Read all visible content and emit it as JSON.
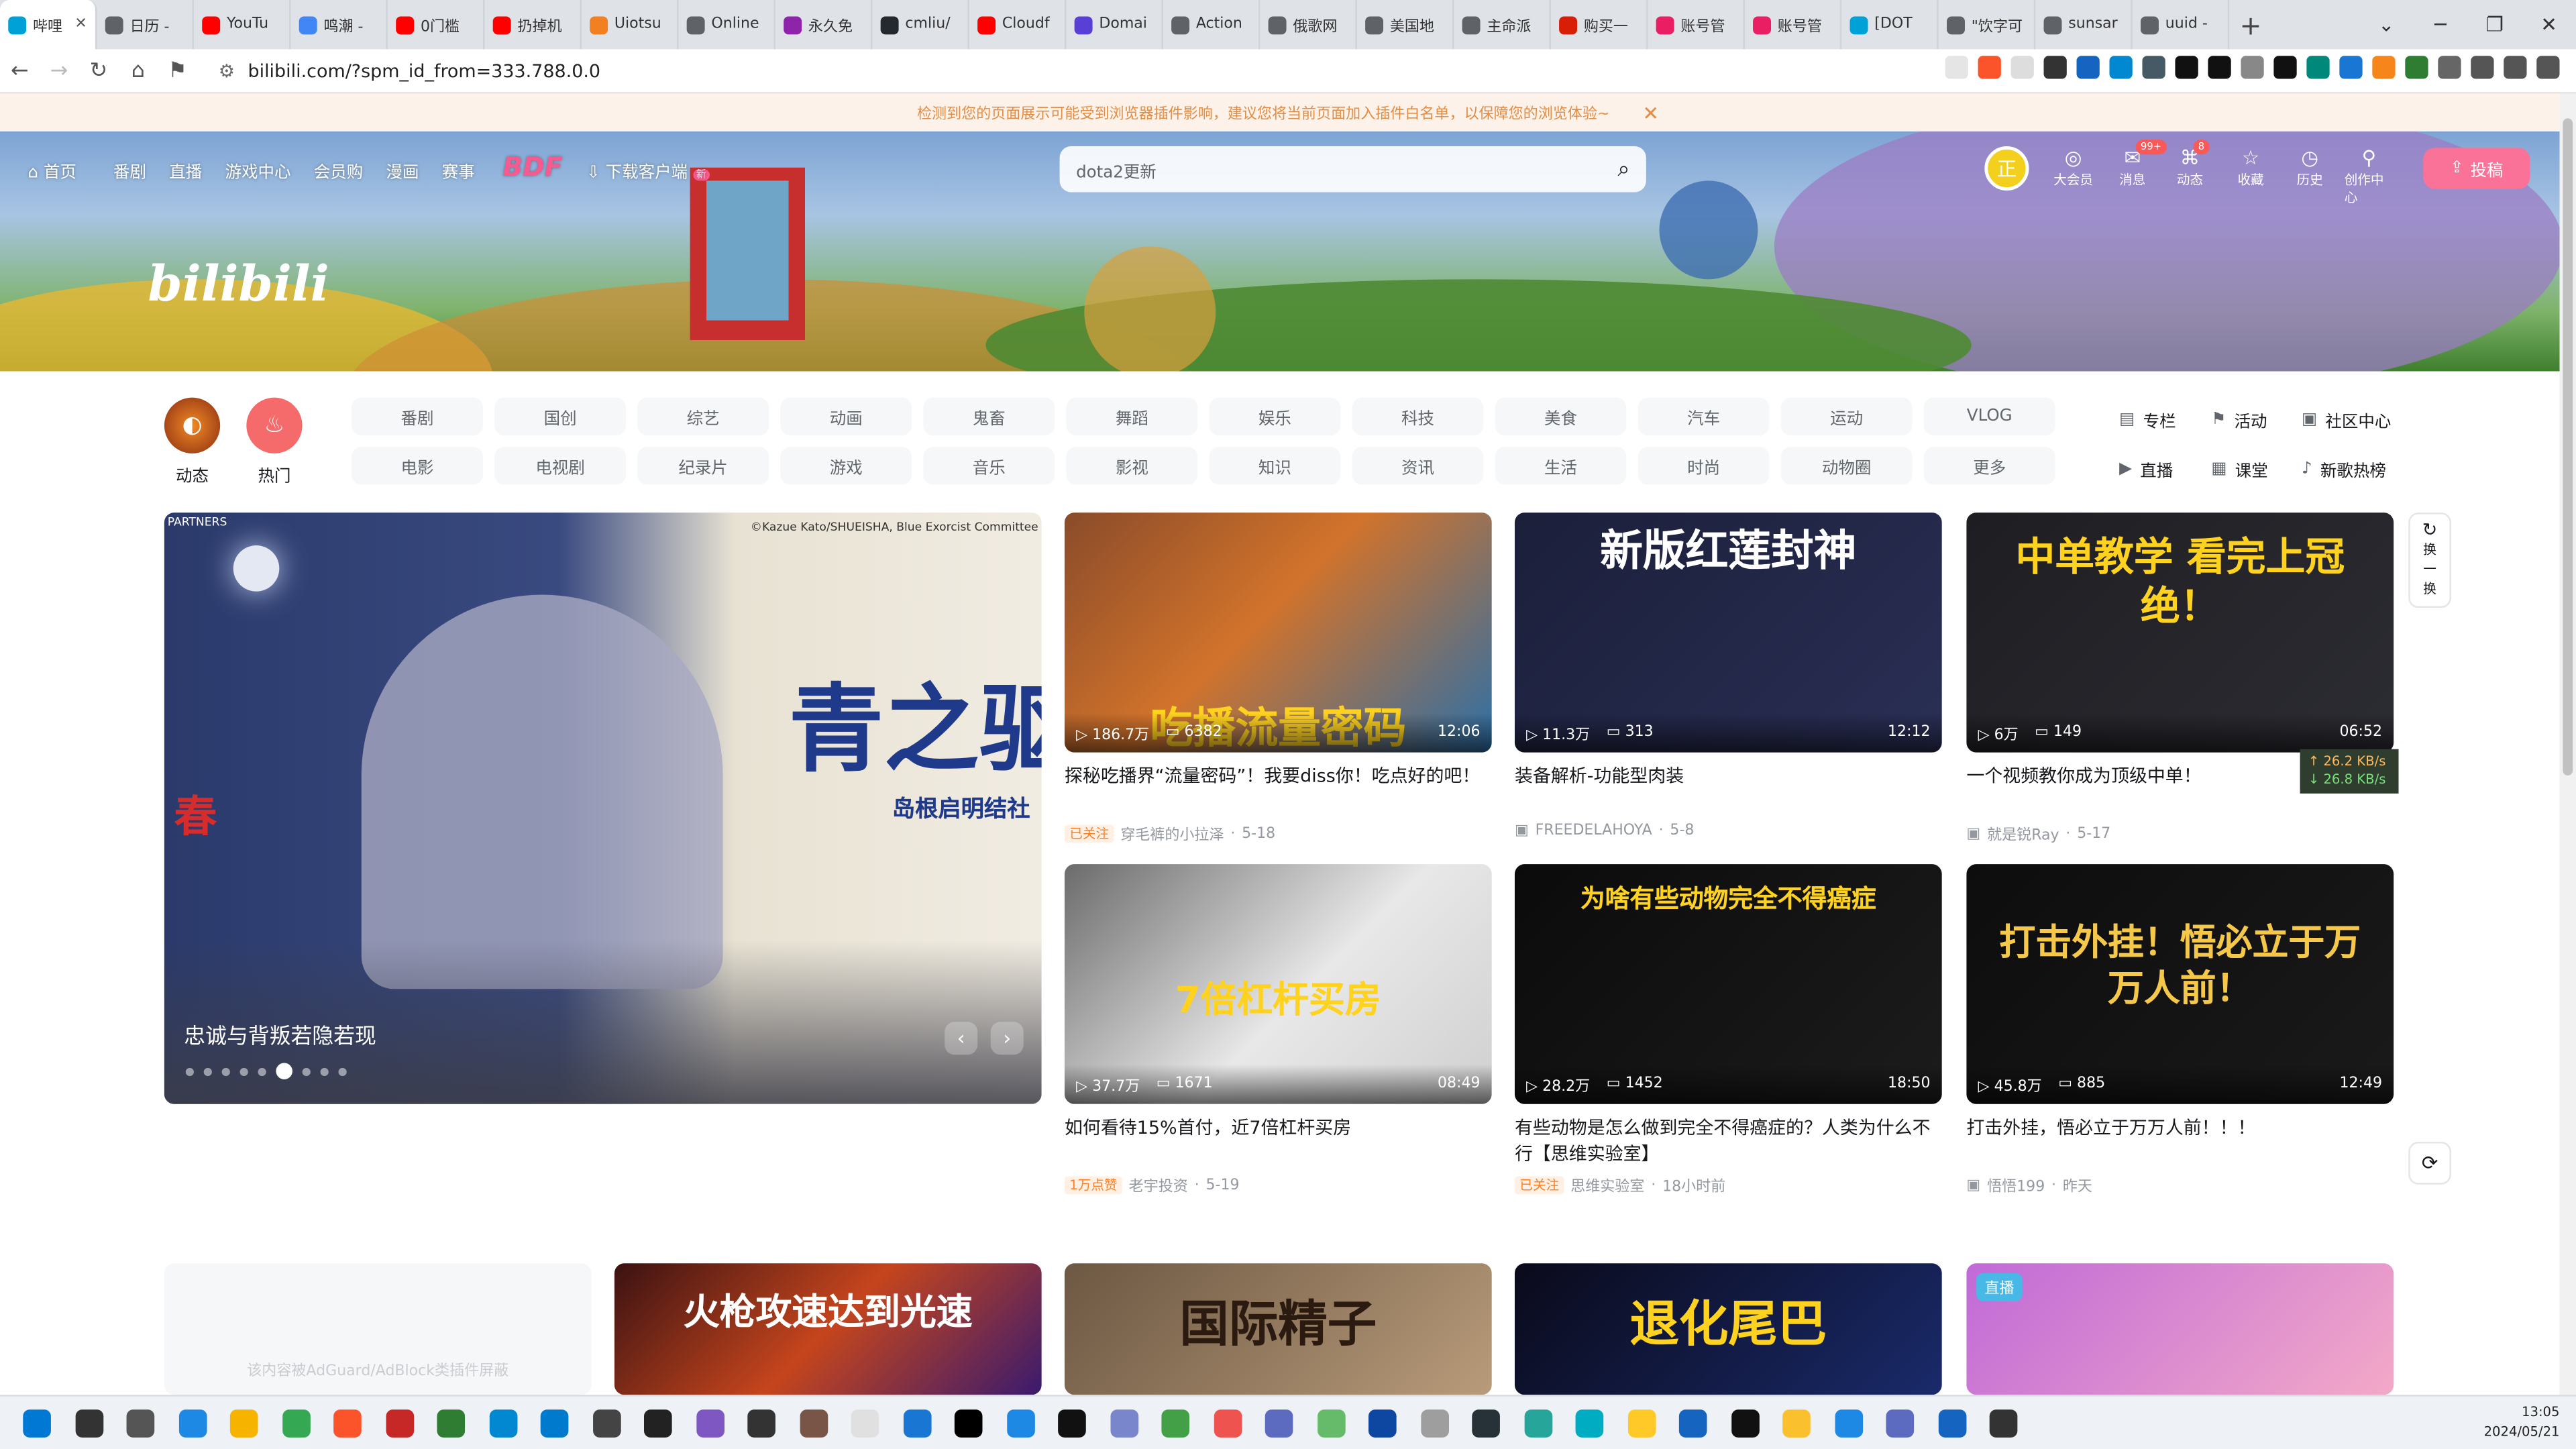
{
  "browser": {
    "tabs": [
      {
        "title": "哔哩",
        "color": "#00a1d6"
      },
      {
        "title": "日历 -",
        "color": "#5f6368"
      },
      {
        "title": "YouTu",
        "color": "#ff0000"
      },
      {
        "title": "鸣潮 -",
        "color": "#4285f4"
      },
      {
        "title": "0门槛",
        "color": "#ff0000"
      },
      {
        "title": "扔掉机",
        "color": "#ff0000"
      },
      {
        "title": "Uiotsu",
        "color": "#f38020"
      },
      {
        "title": "Online",
        "color": "#5f6368"
      },
      {
        "title": "永久免",
        "color": "#8e24aa"
      },
      {
        "title": "cmliu/",
        "color": "#24292f"
      },
      {
        "title": "Cloudf",
        "color": "#ff0000"
      },
      {
        "title": "Domai",
        "color": "#5a3fd6"
      },
      {
        "title": "Action",
        "color": "#5f6368"
      },
      {
        "title": "俄歌网",
        "color": "#5f6368"
      },
      {
        "title": "美国地",
        "color": "#5f6368"
      },
      {
        "title": "主命派",
        "color": "#5f6368"
      },
      {
        "title": "购买一",
        "color": "#d81e06"
      },
      {
        "title": "账号管",
        "color": "#e91e63"
      },
      {
        "title": "账号管",
        "color": "#e91e63"
      },
      {
        "title": "[DOT",
        "color": "#00a1d6"
      },
      {
        "title": "\"饮字可",
        "color": "#5f6368"
      },
      {
        "title": "sunsar",
        "color": "#5f6368"
      },
      {
        "title": "uuid -",
        "color": "#5f6368"
      }
    ],
    "new_tab": "+",
    "url": "bilibili.com/?spm_id_from=333.788.0.0",
    "warning": "检测到您的页面展示可能受到浏览器插件影响，建议您将当前页面加入插件白名单，以保障您的浏览体验~"
  },
  "topnav": {
    "left": [
      "首页",
      "番剧",
      "直播",
      "游戏中心",
      "会员购",
      "漫画",
      "赛事"
    ],
    "bdf": "BDF",
    "download": "下载客户端",
    "download_badge": "新",
    "search_value": "dota2更新",
    "avatar_text": "正",
    "right": [
      {
        "label": "大会员",
        "icon": "◎",
        "badge": ""
      },
      {
        "label": "消息",
        "icon": "✉",
        "badge": "99+"
      },
      {
        "label": "动态",
        "icon": "⌘",
        "badge": "8"
      },
      {
        "label": "收藏",
        "icon": "☆",
        "badge": ""
      },
      {
        "label": "历史",
        "icon": "◷",
        "badge": ""
      },
      {
        "label": "创作中心",
        "icon": "⚲",
        "badge": ""
      }
    ],
    "upload": "投稿",
    "logo": "bilibili"
  },
  "channels": {
    "dynamic": "动态",
    "hot": "热门",
    "row1": [
      "番剧",
      "国创",
      "综艺",
      "动画",
      "鬼畜",
      "舞蹈",
      "娱乐",
      "科技",
      "美食",
      "汽车",
      "运动",
      "VLOG"
    ],
    "row2": [
      "电影",
      "电视剧",
      "纪录片",
      "游戏",
      "音乐",
      "影视",
      "知识",
      "资讯",
      "生活",
      "时尚",
      "动物圈",
      "更多"
    ],
    "side": [
      "专栏",
      "活动",
      "社区中心",
      "直播",
      "课堂",
      "新歌热榜"
    ]
  },
  "carousel": {
    "title": "忠诚与背叛若隐若现",
    "partners": "PARTNERS",
    "copyright": "©Kazue Kato/SHUEISHA, Blue Exorcist Committee",
    "big_text": "青之驱魔",
    "sub_text": "岛根启明结社",
    "spring": "春"
  },
  "videos": [
    {
      "thumb_text": "吃播流量密码",
      "views": "186.7万",
      "danmaku": "6382",
      "duration": "12:06",
      "title": "探秘吃播界“流量密码”！我要diss你！吃点好的吧！",
      "tag": "已关注",
      "author": "穿毛裤的小拉泽",
      "date": "5-18"
    },
    {
      "thumb_text": "新版红莲封神",
      "views": "11.3万",
      "danmaku": "313",
      "duration": "12:12",
      "title": "装备解析-功能型肉装",
      "tag": "",
      "author": "FREEDELAHOYA",
      "date": "5-8"
    },
    {
      "thumb_text": "中单教学 看完上冠绝！",
      "views": "6万",
      "danmaku": "149",
      "duration": "06:52",
      "title": "一个视频教你成为顶级中单！",
      "tag": "",
      "author": "就是锐Ray",
      "date": "5-17"
    },
    {
      "thumb_text": "7倍杠杆买房",
      "views": "37.7万",
      "danmaku": "1671",
      "duration": "08:49",
      "title": "如何看待15%首付，近7倍杠杆买房",
      "tag": "1万点赞",
      "author": "老宇投资",
      "date": "5-19"
    },
    {
      "thumb_text": "为啥有些动物完全不得癌症",
      "views": "28.2万",
      "danmaku": "1452",
      "duration": "18:50",
      "title": "有些动物是怎么做到完全不得癌症的？人类为什么不行【思维实验室】",
      "tag": "已关注",
      "author": "思维实验室",
      "date": "18小时前"
    },
    {
      "thumb_text": "打击外挂！悟必立于万万人前！",
      "views": "45.8万",
      "danmaku": "885",
      "duration": "12:49",
      "title": "打击外挂，悟必立于万万人前！！！",
      "tag": "",
      "author": "悟悟199",
      "date": "昨天"
    }
  ],
  "bottom_thumbs": [
    "火枪攻速达到光速",
    "国际精子",
    "退化尾巴",
    "直播"
  ],
  "adblock_text": "该内容被AdGuard/AdBlock类插件屏蔽",
  "refresh_label": "换一换",
  "speed": {
    "up": "↑ 26.2 KB/s",
    "down": "↓ 26.8 KB/s"
  },
  "taskbar": {
    "time": "13:05",
    "date": "2024/05/21"
  }
}
